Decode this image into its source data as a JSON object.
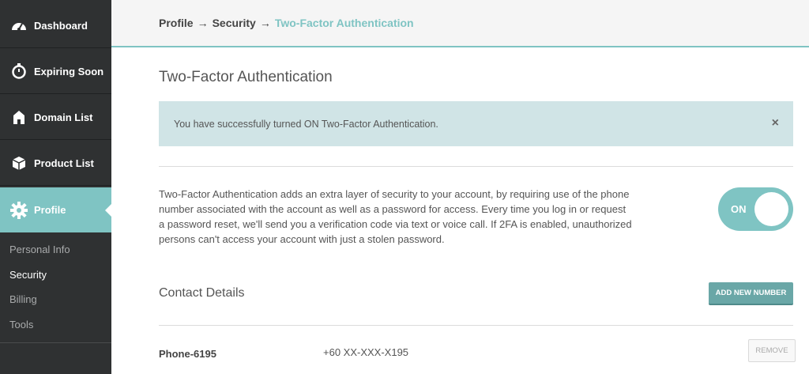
{
  "sidebar": {
    "items": [
      {
        "label": "Dashboard",
        "icon": "speedometer-icon"
      },
      {
        "label": "Expiring Soon",
        "icon": "stopwatch-icon"
      },
      {
        "label": "Domain List",
        "icon": "house-icon"
      },
      {
        "label": "Product List",
        "icon": "box-icon"
      },
      {
        "label": "Profile",
        "icon": "gear-icon"
      }
    ],
    "sub_items": [
      {
        "label": "Personal Info"
      },
      {
        "label": "Security"
      },
      {
        "label": "Billing"
      },
      {
        "label": "Tools"
      }
    ]
  },
  "breadcrumb": {
    "items": [
      "Profile",
      "Security",
      "Two-Factor Authentication"
    ],
    "separator": "→"
  },
  "main": {
    "title": "Two-Factor Authentication",
    "alert": {
      "message": "You have successfully turned ON Two-Factor Authentication.",
      "close_symbol": "×"
    },
    "description": "Two-Factor Authentication adds an extra layer of security to your account, by requiring use of the phone number associated with the account as well as a password for access. Every time you log in or request a password reset, we'll send you a verification code via text or voice call. If 2FA is enabled, unauthorized persons can't access your account with just a stolen password.",
    "toggle": {
      "label": "ON",
      "state": "on"
    },
    "contact": {
      "title": "Contact Details",
      "add_button": "ADD NEW NUMBER",
      "phones": [
        {
          "label": "Phone-6195",
          "number": "+60 XX-XXX-X195",
          "remove_label": "REMOVE"
        }
      ]
    }
  },
  "colors": {
    "accent": "#7fc4c3",
    "sidebar_bg": "#2f3132",
    "alert_bg": "#d0e4e6",
    "button_bg": "#6aa7a7"
  }
}
